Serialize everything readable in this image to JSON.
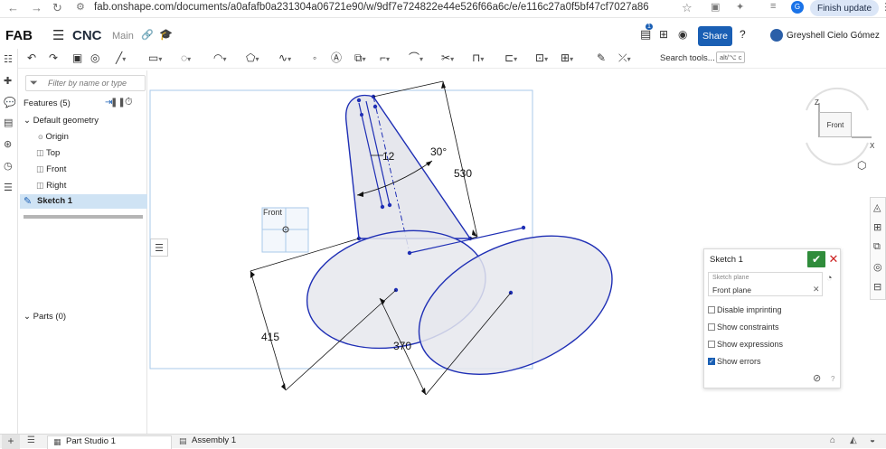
{
  "browser": {
    "url": "fab.onshape.com/documents/a0afafb0a231304a06721e90/w/9df7e724822e44e526f66a6c/e/e116c27a0f5bf47cf7027a86",
    "finish_update": "Finish update",
    "profile_initial": "G"
  },
  "header": {
    "logo": "FAB",
    "doc_title": "CNC",
    "workspace": "Main",
    "notification_count": "1",
    "share_label": "Share",
    "user_name": "Greyshell Cielo Gómez"
  },
  "toolbar": {
    "search_label": "Search tools...",
    "search_shortcut": "alt/⌥ c"
  },
  "features": {
    "filter_placeholder": "Filter by name or type",
    "title": "Features (5)",
    "default_geometry": "Default geometry",
    "items": [
      "Origin",
      "Top",
      "Front",
      "Right"
    ],
    "sketch": "Sketch 1",
    "parts": "Parts (0)"
  },
  "sketch": {
    "plane_label": "Front",
    "dimensions": {
      "d12": "12",
      "angle": "30°",
      "d530": "530",
      "d415": "415",
      "d370": "370"
    },
    "colors": {
      "entity": "#1f2fb5",
      "fill": "#e6e7ed",
      "frame": "#a9c8ea"
    }
  },
  "dialog": {
    "title": "Sketch 1",
    "plane_field_label": "Sketch plane",
    "plane_value": "Front plane",
    "options": [
      {
        "label": "Disable imprinting",
        "checked": false
      },
      {
        "label": "Show constraints",
        "checked": false
      },
      {
        "label": "Show expressions",
        "checked": false
      },
      {
        "label": "Show errors",
        "checked": true
      }
    ]
  },
  "view_cube": {
    "face": "Front",
    "axis_z": "Z",
    "axis_x": "X"
  },
  "tabs": {
    "part_studio": "Part Studio 1",
    "assembly": "Assembly 1"
  }
}
